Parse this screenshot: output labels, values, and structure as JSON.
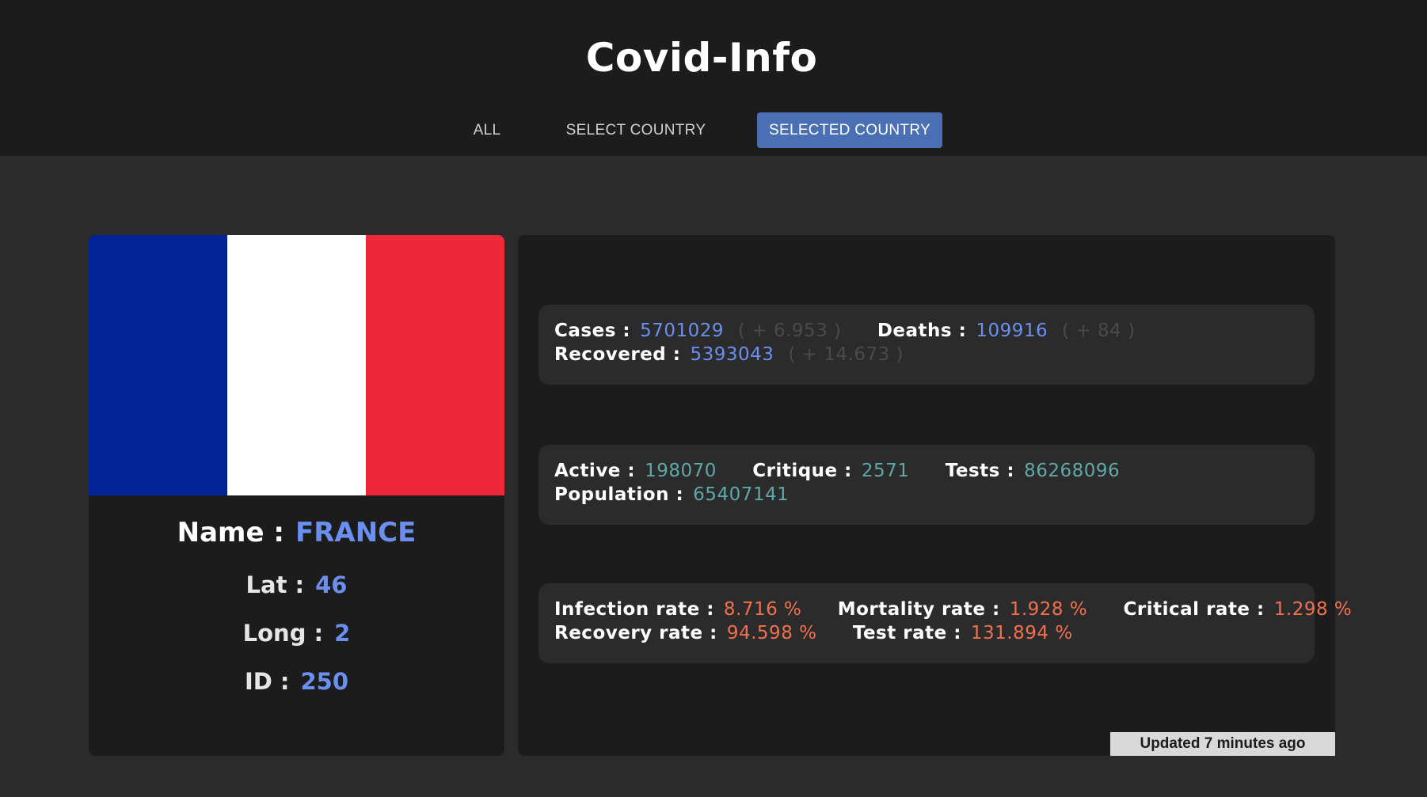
{
  "app": {
    "title": "Covid-Info"
  },
  "nav": {
    "all": "ALL",
    "select_country": "SELECT COUNTRY",
    "selected_country": "SELECTED COUNTRY",
    "active_tab": "selected_country"
  },
  "country": {
    "name_label": "Name :",
    "name": "FRANCE",
    "lat_label": "Lat :",
    "lat": "46",
    "long_label": "Long :",
    "long": "2",
    "id_label": "ID :",
    "id": "250",
    "flag_colors": [
      "#002395",
      "#ffffff",
      "#ed2939"
    ]
  },
  "stats": {
    "cases_label": "Cases :",
    "cases": "5701029",
    "cases_delta": "( + 6.953 )",
    "deaths_label": "Deaths :",
    "deaths": "109916",
    "deaths_delta": "( + 84 )",
    "recovered_label": "Recovered :",
    "recovered": "5393043",
    "recovered_delta": "( + 14.673 )",
    "active_label": "Active :",
    "active": "198070",
    "critique_label": "Critique :",
    "critique": "2571",
    "tests_label": "Tests :",
    "tests": "86268096",
    "population_label": "Population :",
    "population": "65407141",
    "infection_rate_label": "Infection rate :",
    "infection_rate": "8.716 %",
    "mortality_rate_label": "Mortality rate :",
    "mortality_rate": "1.928 %",
    "critical_rate_label": "Critical rate :",
    "critical_rate": "1.298 %",
    "recovery_rate_label": "Recovery rate :",
    "recovery_rate": "94.598 %",
    "test_rate_label": "Test rate :",
    "test_rate": "131.894 %"
  },
  "footer": {
    "updated": "Updated 7 minutes ago"
  },
  "colors": {
    "accent": "#4a6fb5",
    "value_blue": "#6b8ff0",
    "value_teal": "#5fa8a8",
    "value_orange": "#f07050"
  }
}
